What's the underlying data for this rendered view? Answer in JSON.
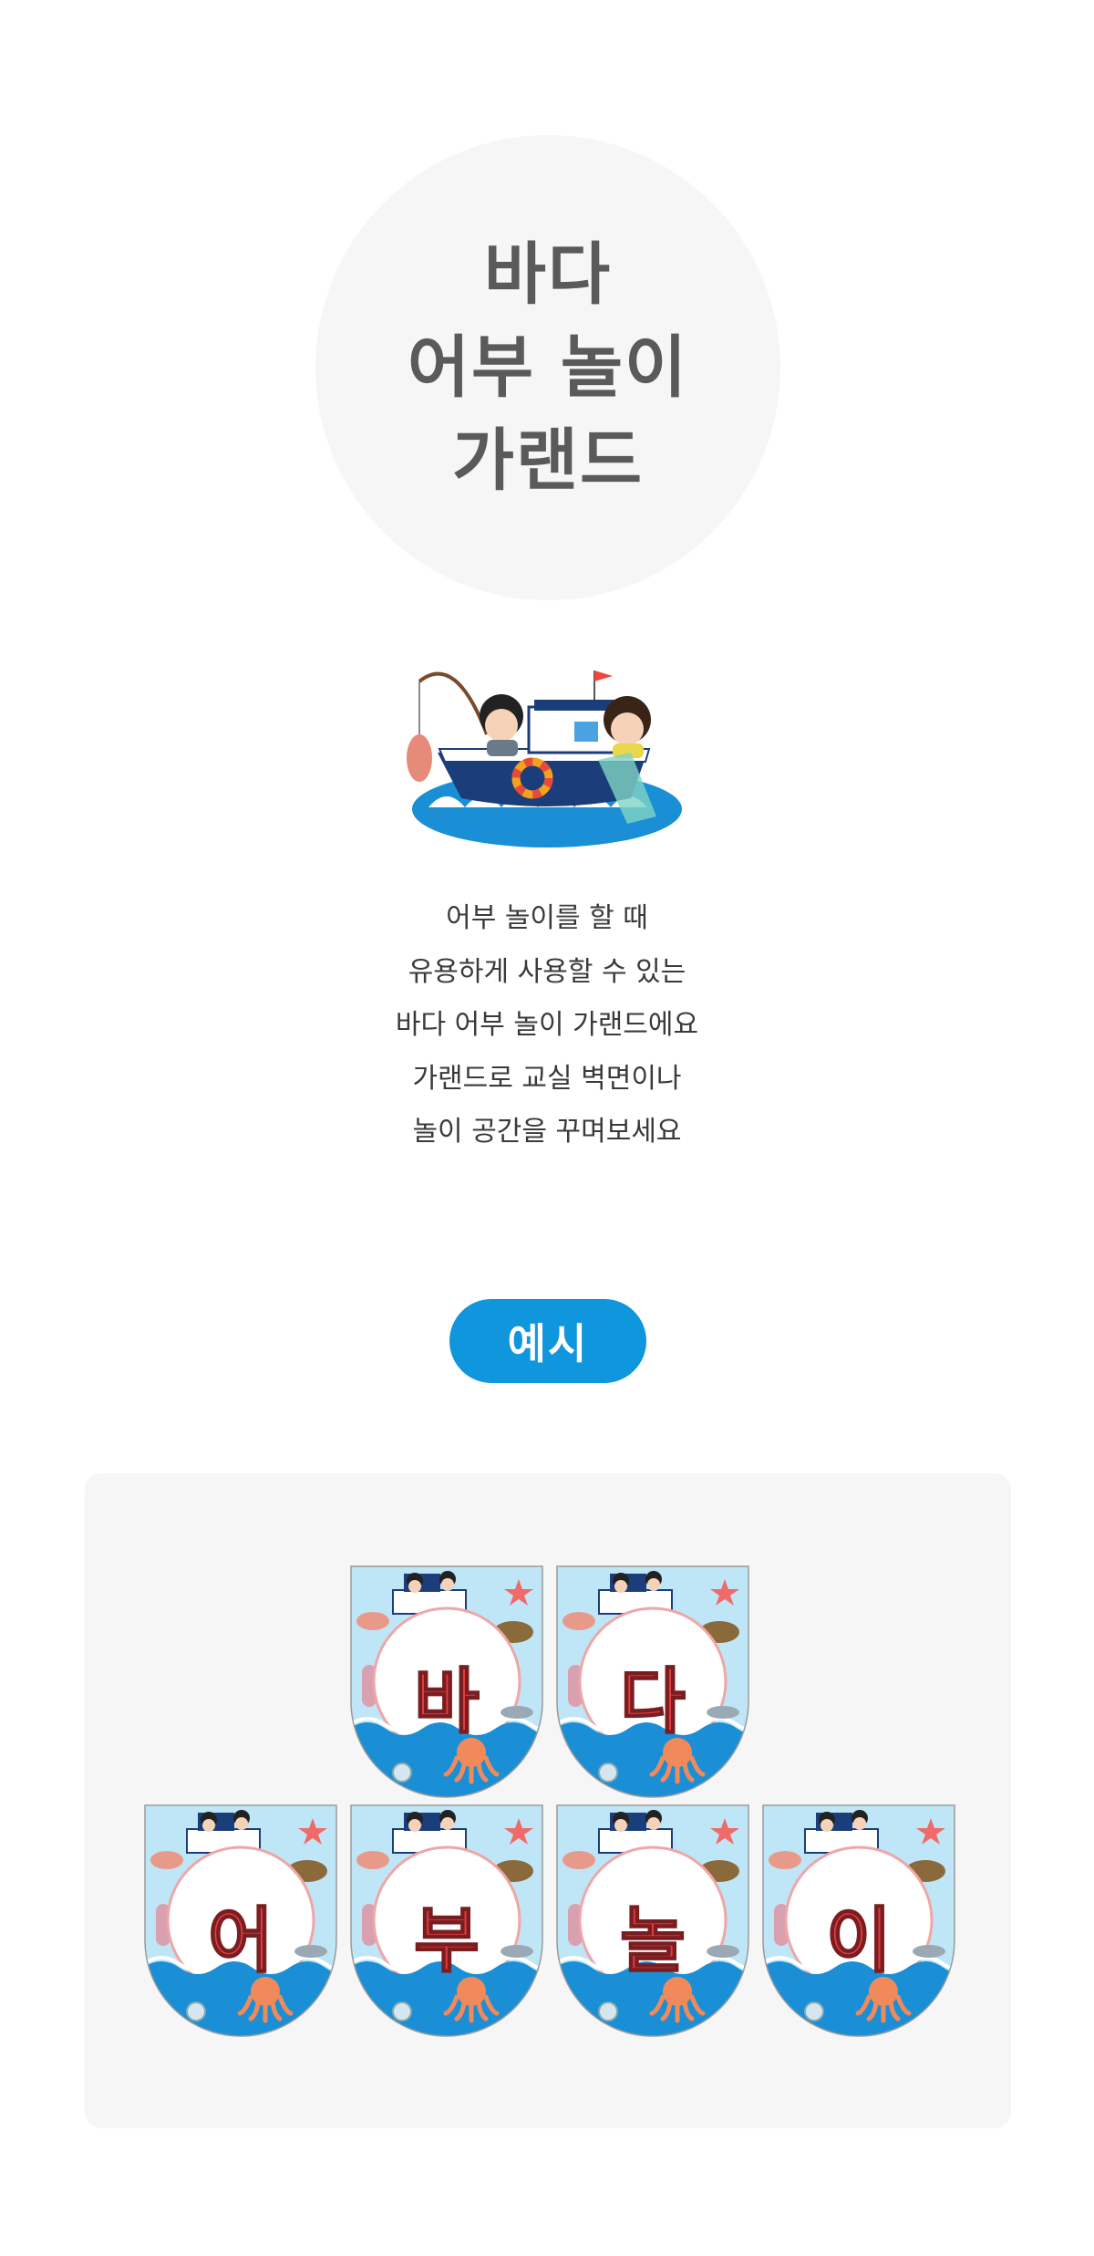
{
  "title": {
    "lines": [
      "바다",
      "어부 놀이",
      "가랜드"
    ]
  },
  "description": {
    "lines": [
      "어부 놀이를 할 때",
      "유용하게 사용할 수 있는",
      "바다 어부 놀이 가랜드에요",
      "가랜드로 교실 벽면이나",
      "놀이 공간을 꾸며보세요"
    ]
  },
  "example_badge": {
    "label": "예시"
  },
  "garland": {
    "row1": [
      "바",
      "다"
    ],
    "row2": [
      "어",
      "부",
      "놀",
      "이"
    ]
  },
  "colors": {
    "badge": "#0f96dd",
    "title_bg": "#f6f6f6",
    "letter": "#e23c40",
    "sea": "#1a8fd6",
    "sky": "#bfe6f7"
  },
  "icons": {
    "hero": "fishing-boat-illustration",
    "pennant_decor": [
      "boat",
      "octopus",
      "squid",
      "fish",
      "starfish",
      "shell"
    ]
  }
}
